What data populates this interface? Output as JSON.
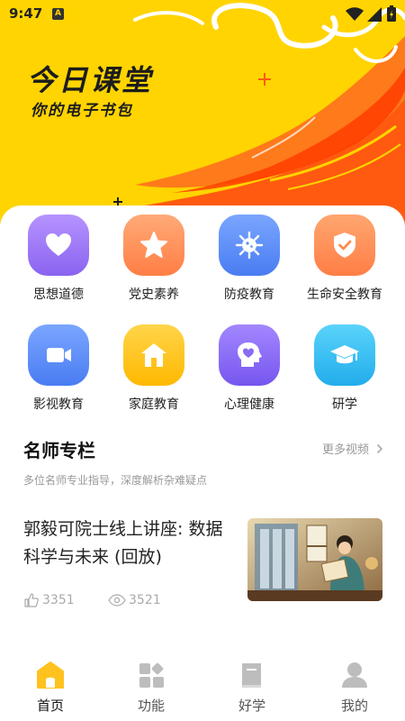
{
  "status_bar": {
    "time": "9:47",
    "notification_badge": "A"
  },
  "hero": {
    "title": "今日课堂",
    "subtitle": "你的电子书包",
    "bg_color": "#FFD400"
  },
  "categories": [
    {
      "label": "思想道德",
      "icon": "heart-icon",
      "color": "#A07CF5"
    },
    {
      "label": "党史素养",
      "icon": "star-icon",
      "color": "#FF8F5A"
    },
    {
      "label": "防疫教育",
      "icon": "virus-icon",
      "color": "#5B8DF6"
    },
    {
      "label": "生命安全教育",
      "icon": "shield-check-icon",
      "color": "#FF8C52"
    },
    {
      "label": "影视教育",
      "icon": "video-camera-icon",
      "color": "#5B8DF6"
    },
    {
      "label": "家庭教育",
      "icon": "house-icon",
      "color": "#FFC21E"
    },
    {
      "label": "心理健康",
      "icon": "head-heart-icon",
      "color": "#8A6CF2"
    },
    {
      "label": "研学",
      "icon": "graduation-cap-icon",
      "color": "#34C2F2"
    }
  ],
  "section": {
    "title": "名师专栏",
    "more": "更多视频",
    "description": "多位名师专业指导，深度解析杂难疑点"
  },
  "article": {
    "title": "郭毅可院士线上讲座: 数据科学与未来 (回放)",
    "likes": "3351",
    "views": "3521"
  },
  "bottom_nav": [
    {
      "label": "首页",
      "icon": "home-icon",
      "active": true
    },
    {
      "label": "功能",
      "icon": "grid-icon",
      "active": false
    },
    {
      "label": "好学",
      "icon": "book-icon",
      "active": false
    },
    {
      "label": "我的",
      "icon": "user-icon",
      "active": false
    }
  ]
}
